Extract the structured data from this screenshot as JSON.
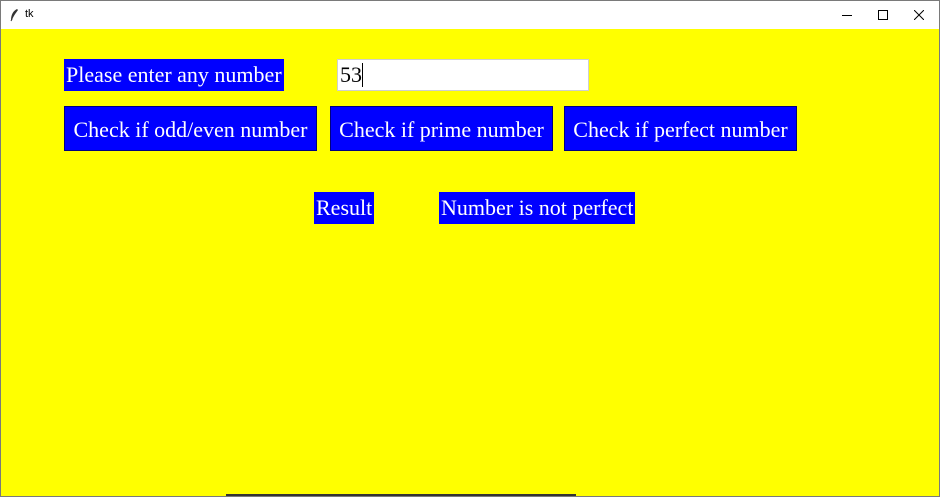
{
  "window": {
    "title": "tk",
    "app_icon": "feather-icon",
    "controls": {
      "minimize": "minimize-icon",
      "maximize": "maximize-icon",
      "close": "close-icon"
    }
  },
  "form": {
    "prompt_label": "Please enter any number",
    "number_input_value": "53"
  },
  "buttons": {
    "odd_even": "Check if odd/even number",
    "prime": "Check if prime number",
    "perfect": "Check if perfect number"
  },
  "result": {
    "label": "Result",
    "value": "Number is not perfect"
  },
  "colors": {
    "background": "#ffff00",
    "widget_bg": "#0000ff",
    "widget_fg": "#ffffff"
  }
}
